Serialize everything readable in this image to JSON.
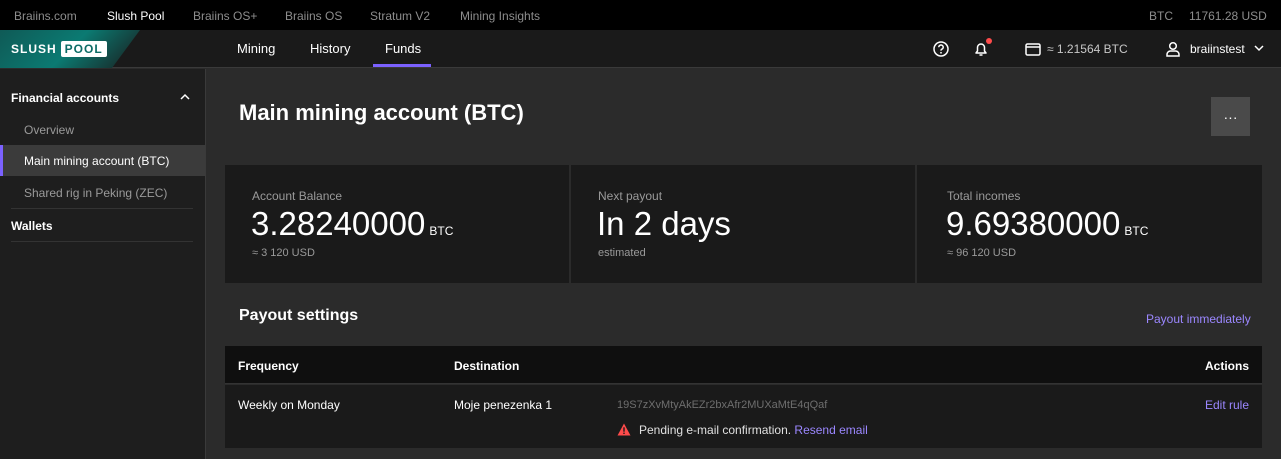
{
  "topbar": {
    "links": [
      "Braiins.com",
      "Slush Pool",
      "Braiins OS+",
      "Braiins OS",
      "Stratum V2",
      "Mining Insights"
    ],
    "currency": "BTC",
    "price": "11761.28 USD"
  },
  "header": {
    "logo_left": "SLUSH",
    "logo_right": "POOL",
    "nav": [
      "Mining",
      "History",
      "Funds"
    ],
    "active_nav": "Funds",
    "wallet_balance": "≈ 1.21564 BTC",
    "username": "braiinstest"
  },
  "sidebar": {
    "section": "Financial accounts",
    "items": [
      "Overview",
      "Main mining account (BTC)",
      "Shared rig in Peking (ZEC)"
    ],
    "active_item": "Main mining account (BTC)",
    "wallets": "Wallets"
  },
  "main": {
    "title": "Main mining account (BTC)",
    "more_label": "···",
    "cards": [
      {
        "label": "Account Balance",
        "value": "3.28240000",
        "unit": "BTC",
        "sub": "≈ 3 120 USD"
      },
      {
        "label": "Next payout",
        "value": "In 2 days",
        "unit": "",
        "sub": "estimated"
      },
      {
        "label": "Total incomes",
        "value": "9.69380000",
        "unit": "BTC",
        "sub": "≈ 96 120 USD"
      }
    ],
    "payout": {
      "title": "Payout settings",
      "action": "Payout immediately",
      "columns": [
        "Frequency",
        "Destination",
        "Actions"
      ],
      "row": {
        "frequency": "Weekly on Monday",
        "destination": "Moje penezenka 1",
        "address": "19S7zXvMtyAkEZr2bxAfr2MUXaMtE4qQaf",
        "action": "Edit rule",
        "warning": "Pending e-mail confirmation.",
        "resend": "Resend email"
      }
    }
  },
  "colors": {
    "accent": "#7b61ff",
    "link": "#9b87ff",
    "warning": "#ff4b4b"
  }
}
